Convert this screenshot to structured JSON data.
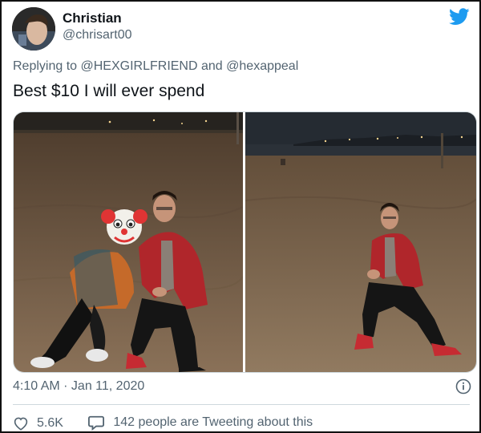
{
  "tweet": {
    "author_name": "Christian",
    "author_handle": "@chrisart00",
    "replying_label": "Replying to",
    "reply_mention_1": "@HEXGIRLFRIEND",
    "reply_connector": "and",
    "reply_mention_2": "@hexappeal",
    "text": "Best $10 I will ever spend",
    "timestamp": "4:10 AM · Jan 11, 2020"
  },
  "actions": {
    "likes": "5.6K",
    "discussion": "142 people are Tweeting about this"
  },
  "icons": {
    "brand": "twitter-bird-icon",
    "info": "info-icon",
    "like": "heart-icon",
    "reply": "speech-bubble-icon",
    "overlay": "clown-face-emoji"
  },
  "colors": {
    "twitter_blue": "#1d9bf0",
    "muted_text": "#536471",
    "jacket_red": "#b0262b"
  }
}
